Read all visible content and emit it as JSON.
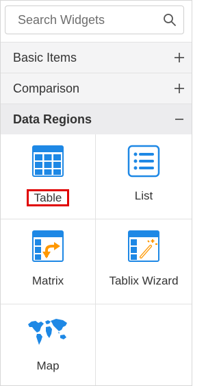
{
  "search": {
    "placeholder": "Search Widgets",
    "value": ""
  },
  "sections": [
    {
      "label": "Basic Items",
      "toggle": "+",
      "expanded": false
    },
    {
      "label": "Comparison",
      "toggle": "+",
      "expanded": false
    },
    {
      "label": "Data Regions",
      "toggle": "−",
      "expanded": true
    }
  ],
  "widgets": [
    {
      "label": "Table",
      "icon": "table-icon",
      "highlighted": true
    },
    {
      "label": "List",
      "icon": "list-icon",
      "highlighted": false
    },
    {
      "label": "Matrix",
      "icon": "matrix-icon",
      "highlighted": false
    },
    {
      "label": "Tablix Wizard",
      "icon": "tablix-wizard-icon",
      "highlighted": false
    },
    {
      "label": "Map",
      "icon": "map-icon",
      "highlighted": false
    }
  ],
  "colors": {
    "accent": "#1e88e5",
    "accent_secondary": "#ff9800",
    "highlight_border": "#e00000",
    "header_bg": "#f4f4f5"
  }
}
